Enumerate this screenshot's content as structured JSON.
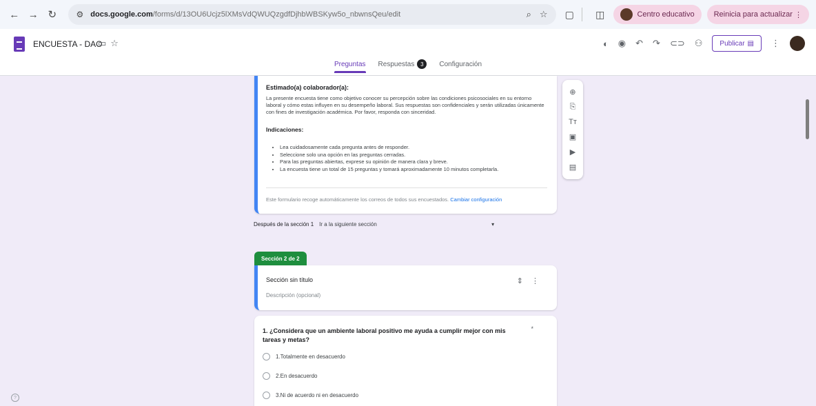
{
  "browser": {
    "url_host": "docs.google.com",
    "url_path": "/forms/d/13OU6Ucjz5lXMsVdQWUQzgdfDjhbWBSKyw5o_nbwnsQeu/edit",
    "profile_label": "Centro educativo",
    "update_label": "Reinicia para actualizar"
  },
  "header": {
    "doc_title": "ENCUESTA - DAO",
    "publish_label": "Publicar",
    "tabs": [
      {
        "label": "Preguntas"
      },
      {
        "label": "Respuestas",
        "badge": "3"
      },
      {
        "label": "Configuración"
      }
    ]
  },
  "intro": {
    "heading": "Estimado(a) colaborador(a):",
    "paragraph": "La presente encuesta tiene como objetivo conocer su percepción sobre las condiciones psicosociales en su entorno laboral y cómo estas influyen en su desempeño laboral. Sus respuestas son confidenciales y serán utilizadas únicamente con fines de investigación académica. Por favor, responda con sinceridad.",
    "instructions_heading": "Indicaciones:",
    "instructions": [
      "Lea cuidadosamente cada pregunta antes de responder.",
      "Seleccione solo una opción en las preguntas cerradas.",
      "Para las preguntas abiertas, exprese su opinión de manera clara y breve.",
      "La encuesta tiene un total de 15 preguntas y tomará aproximadamente 10 minutos completarla."
    ],
    "note": "Este formulario recoge automáticamente los correos de todos sus encuestados.",
    "note_link": "Cambiar configuración"
  },
  "navigation": {
    "after_section_label": "Después de la sección 1",
    "after_section_value": "Ir a la siguiente sección"
  },
  "section": {
    "tab_label": "Sección 2 de 2",
    "title": "Sección sin título",
    "description": "Descripción (opcional)"
  },
  "question": {
    "text": "1. ¿Considera que un ambiente laboral positivo me ayuda a cumplir mejor con mis tareas y metas?",
    "required_mark": "*",
    "options": [
      "1.Totalmente en desacuerdo",
      "2.En desacuerdo",
      "3.Ni de acuerdo ni en desacuerdo"
    ]
  }
}
